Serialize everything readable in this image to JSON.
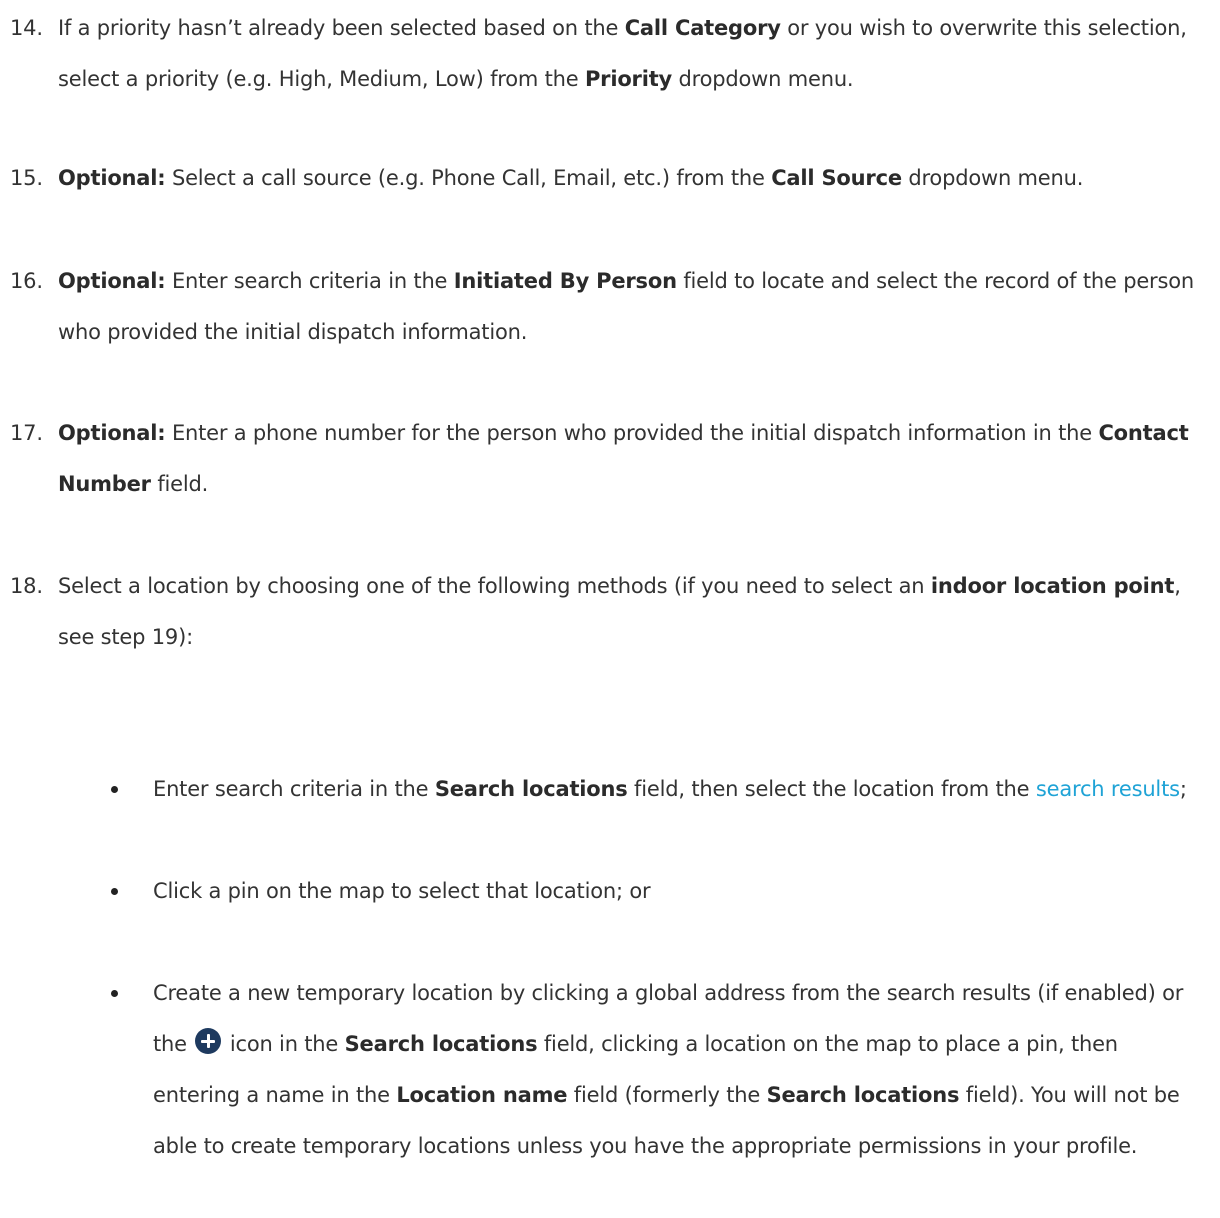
{
  "steps": [
    {
      "number": "14.",
      "segments": [
        {
          "t": "If a priority hasn’t already been selected based on the "
        },
        {
          "t": "Call Category",
          "b": true
        },
        {
          "t": " or you wish to overwrite this selection, select a priority (e.g. High, Medium, Low) from the "
        },
        {
          "t": "Priority",
          "b": true
        },
        {
          "t": " dropdown menu."
        }
      ]
    },
    {
      "number": "15.",
      "segments": [
        {
          "t": "Optional:",
          "b": true
        },
        {
          "t": " Select a call source (e.g. Phone Call, Email, etc.) from the "
        },
        {
          "t": "Call Source",
          "b": true
        },
        {
          "t": " dropdown menu."
        }
      ]
    },
    {
      "number": "16.",
      "segments": [
        {
          "t": "Optional:",
          "b": true
        },
        {
          "t": " Enter search criteria in the "
        },
        {
          "t": "Initiated By Person",
          "b": true
        },
        {
          "t": " field to locate and select the record of the person who provided the initial dispatch information."
        }
      ]
    },
    {
      "number": "17.",
      "segments": [
        {
          "t": "Optional:",
          "b": true
        },
        {
          "t": " Enter a phone number for the person who provided the initial dispatch information in the "
        },
        {
          "t": "Contact Number",
          "b": true
        },
        {
          "t": " field."
        }
      ]
    },
    {
      "number": "18.",
      "segments": [
        {
          "t": "Select a location by choosing one of the following methods (if you need to select an "
        },
        {
          "t": "indoor location point",
          "b": true
        },
        {
          "t": ", see step 19):"
        }
      ]
    }
  ],
  "bullets": [
    {
      "segments": [
        {
          "t": "Enter search criteria in the "
        },
        {
          "t": "Search locations",
          "b": true
        },
        {
          "t": " field, then select the location from the "
        },
        {
          "t": "search results",
          "link": true
        },
        {
          "t": ";"
        }
      ]
    },
    {
      "segments": [
        {
          "t": "Click a pin on the map to select that location; or"
        }
      ]
    },
    {
      "segments": [
        {
          "t": "Create a new temporary location by clicking a global address from the search results (if enabled) or the"
        },
        {
          "icon": "add-circle-icon"
        },
        {
          "t": "icon in the "
        },
        {
          "t": "Search locations",
          "b": true
        },
        {
          "t": " field, clicking a location on the map to place a pin, then entering a name in the "
        },
        {
          "t": "Location name",
          "b": true
        },
        {
          "t": " field (formerly the "
        },
        {
          "t": "Search locations",
          "b": true
        },
        {
          "t": " field). You will not be able to create temporary locations unless you have the appropriate permissions in your profile."
        }
      ]
    }
  ],
  "colors": {
    "text": "#333333",
    "link": "#1fa3d6",
    "icon": "#1e3a5f"
  }
}
